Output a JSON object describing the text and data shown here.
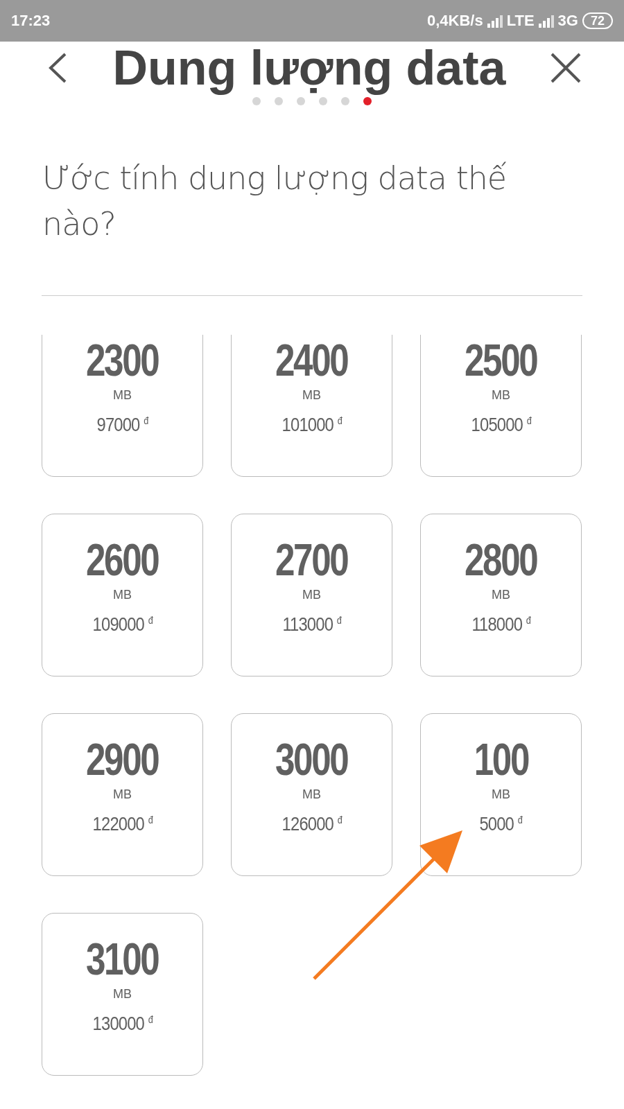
{
  "status_bar": {
    "time": "17:23",
    "speed": "0,4KB/s",
    "network_1": "LTE",
    "network_2": "3G",
    "battery": "72"
  },
  "header": {
    "title": "Dung lượng data"
  },
  "steps": [
    {
      "selected": false
    },
    {
      "selected": false
    },
    {
      "selected": false
    },
    {
      "selected": false
    },
    {
      "selected": false
    },
    {
      "selected": true
    }
  ],
  "question": "Ước tính dung lượng data thế nào?",
  "packages": [
    {
      "amount": "2300",
      "unit": "MB",
      "price": "97000 $^{đ}$"
    },
    {
      "amount": "2400",
      "unit": "MB",
      "price": "101000 $^{đ}$"
    },
    {
      "amount": "2500",
      "unit": "MB",
      "price": "105000 $^{đ}$"
    },
    {
      "amount": "2600",
      "unit": "MB",
      "price": "109000 $^{đ}$"
    },
    {
      "amount": "2700",
      "unit": "MB",
      "price": "113000 $^{đ}$"
    },
    {
      "amount": "2800",
      "unit": "MB",
      "price": "118000 $^{đ}$"
    },
    {
      "amount": "2900",
      "unit": "MB",
      "price": "122000 $^{đ}$"
    },
    {
      "amount": "3000",
      "unit": "MB",
      "price": "126000 $^{đ}$"
    },
    {
      "amount": "100",
      "unit": "MB",
      "price": "5000 $^{đ}$"
    },
    {
      "amount": "3100",
      "unit": "MB",
      "price": "130000 $^{đ}$"
    }
  ],
  "annotation": {
    "kind": "arrow"
  }
}
